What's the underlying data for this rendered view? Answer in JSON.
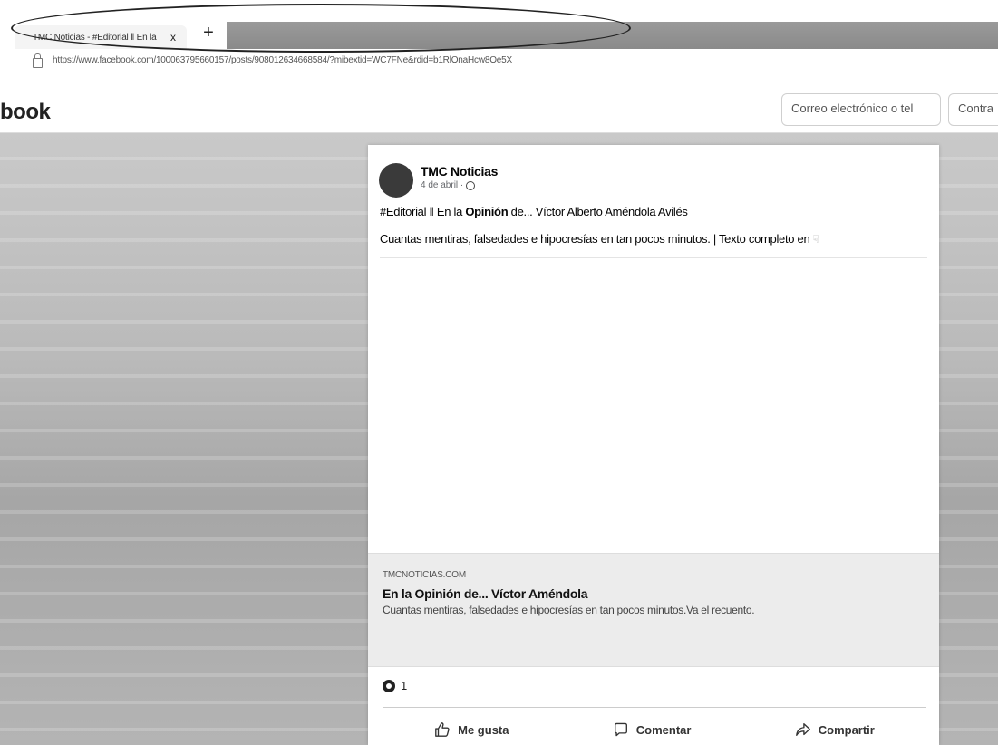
{
  "browser": {
    "tab_title": "TMC Noticias - #Editorial ‖ En la",
    "tab_close": "x",
    "new_tab": "+",
    "url": "https://www.facebook.com/100063795660157/posts/908012634668584/?mibextid=WC7FNe&rdid=b1RlOnaHcw8Oe5X"
  },
  "header": {
    "logo": "book",
    "email_placeholder": "Correo electrónico o tel",
    "password_placeholder": "Contra"
  },
  "post": {
    "author": "TMC Noticias",
    "date": "4 de abril ·",
    "headline_prefix": "#Editorial ‖ En la ",
    "headline_bold": "Opinión",
    "headline_suffix": " de... Víctor Alberto Améndola Avilés",
    "text": "Cuantas mentiras, falsedades e hipocresías en tan pocos minutos. | Texto completo en",
    "link": {
      "domain": "TMCNOTICIAS.COM",
      "title": "En la Opinión de... Víctor Améndola",
      "description": "Cuantas mentiras, falsedades e hipocresías en tan pocos minutos.Va el recuento."
    },
    "reaction_count": "1",
    "actions": {
      "like": "Me gusta",
      "comment": "Comentar",
      "share": "Compartir"
    }
  },
  "icons": {
    "lock": "lock-icon",
    "globe": "globe-icon",
    "pointer": "pointer-icon",
    "like": "thumbs-up-icon",
    "comment": "comment-icon",
    "share": "share-icon"
  }
}
